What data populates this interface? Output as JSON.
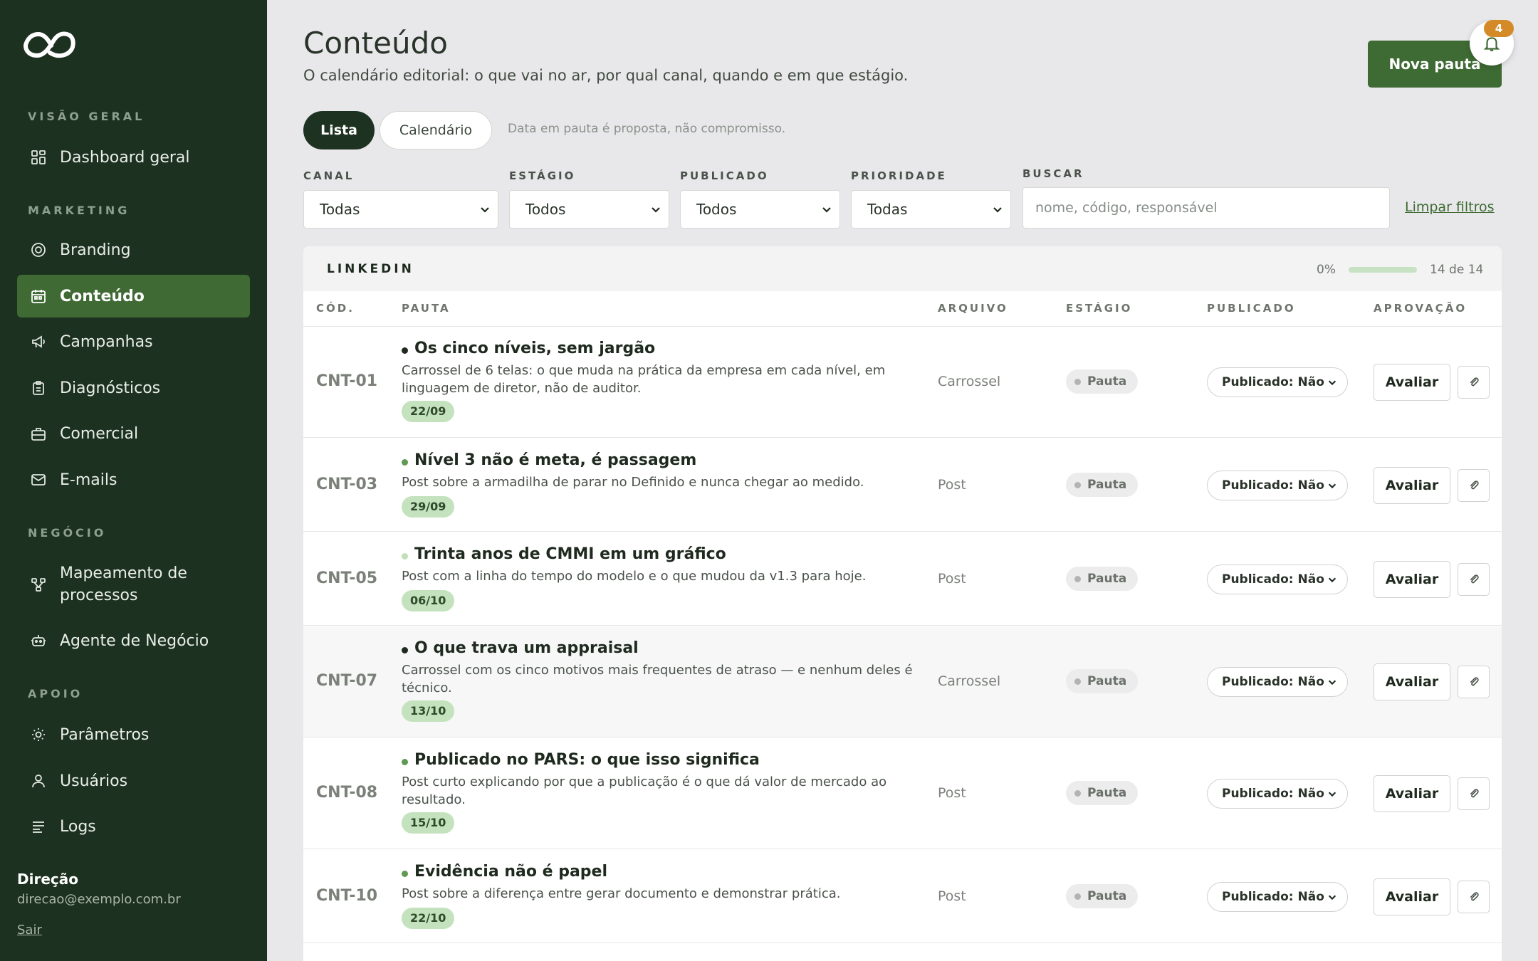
{
  "sidebar": {
    "sections": [
      {
        "label": "VISÃO GERAL"
      },
      {
        "label": "MARKETING"
      },
      {
        "label": "NEGÓCIO"
      },
      {
        "label": "APOIO"
      }
    ],
    "items": [
      {
        "label": "Dashboard geral",
        "icon": "grid-icon"
      },
      {
        "label": "Branding",
        "icon": "target-icon"
      },
      {
        "label": "Conteúdo",
        "icon": "calendar-icon",
        "active": true
      },
      {
        "label": "Campanhas",
        "icon": "megaphone-icon"
      },
      {
        "label": "Diagnósticos",
        "icon": "clipboard-icon"
      },
      {
        "label": "Comercial",
        "icon": "briefcase-icon"
      },
      {
        "label": "E-mails",
        "icon": "mail-icon"
      },
      {
        "label": "Mapeamento de processos",
        "icon": "flow-icon"
      },
      {
        "label": "Agente de Negócio",
        "icon": "bot-icon"
      },
      {
        "label": "Parâmetros",
        "icon": "sun-icon"
      },
      {
        "label": "Usuários",
        "icon": "user-icon"
      },
      {
        "label": "Logs",
        "icon": "list-icon"
      }
    ],
    "user": {
      "name": "Direção",
      "email": "direcao@exemplo.com.br",
      "logout": "Sair"
    }
  },
  "header": {
    "title": "Conteúdo",
    "subtitle": "O calendário editorial: o que vai no ar, por qual canal, quando e em que estágio.",
    "new_button": "Nova pauta",
    "notification_count": "4"
  },
  "view_toggle": {
    "list": "Lista",
    "calendar": "Calendário",
    "note": "Data em pauta é proposta, não compromisso."
  },
  "filters": {
    "canal": {
      "label": "CANAL",
      "value": "Todas"
    },
    "estagio": {
      "label": "ESTÁGIO",
      "value": "Todos"
    },
    "publicado": {
      "label": "PUBLICADO",
      "value": "Todos"
    },
    "prioridade": {
      "label": "PRIORIDADE",
      "value": "Todas"
    },
    "buscar": {
      "label": "BUSCAR",
      "placeholder": "nome, código, responsável",
      "value": ""
    },
    "clear": "Limpar filtros"
  },
  "group": {
    "title": "LINKEDIN",
    "progress_text": "0%",
    "progress_fraction": 0,
    "count_text": "14 de 14",
    "columns": {
      "cod": "CÓD.",
      "pauta": "PAUTA",
      "arquivo": "ARQUIVO",
      "estagio": "ESTÁGIO",
      "publicado": "PUBLICADO",
      "aprovacao": "APROVAÇÃO"
    },
    "rows": [
      {
        "code": "CNT-01",
        "title": "Os cinco níveis, sem jargão",
        "desc": "Carrossel de 6 telas: o que muda na prática da empresa em cada nível, em linguagem de diretor, não de auditor.",
        "date": "22/09",
        "file": "Carrossel",
        "stage": "Pauta",
        "published": "Publicado: Não",
        "approve": "Avaliar",
        "dot_color": "#1f2a1f"
      },
      {
        "code": "CNT-03",
        "title": "Nível 3 não é meta, é passagem",
        "desc": "Post sobre a armadilha de parar no Definido e nunca chegar ao medido.",
        "date": "29/09",
        "file": "Post",
        "stage": "Pauta",
        "published": "Publicado: Não",
        "approve": "Avaliar",
        "dot_color": "#5f9a52"
      },
      {
        "code": "CNT-05",
        "title": "Trinta anos de CMMI em um gráfico",
        "desc": "Post com a linha do tempo do modelo e o que mudou da v1.3 para hoje.",
        "date": "06/10",
        "file": "Post",
        "stage": "Pauta",
        "published": "Publicado: Não",
        "approve": "Avaliar",
        "dot_color": "#bfe0b8"
      },
      {
        "code": "CNT-07",
        "title": "O que trava um appraisal",
        "desc": "Carrossel com os cinco motivos mais frequentes de atraso — e nenhum deles é técnico.",
        "date": "13/10",
        "file": "Carrossel",
        "stage": "Pauta",
        "published": "Publicado: Não",
        "approve": "Avaliar",
        "dot_color": "#1f2a1f"
      },
      {
        "code": "CNT-08",
        "title": "Publicado no PARS: o que isso significa",
        "desc": "Post curto explicando por que a publicação é o que dá valor de mercado ao resultado.",
        "date": "15/10",
        "file": "Post",
        "stage": "Pauta",
        "published": "Publicado: Não",
        "approve": "Avaliar",
        "dot_color": "#5f9a52"
      },
      {
        "code": "CNT-10",
        "title": "Evidência não é papel",
        "desc": "Post sobre a diferença entre gerar documento e demonstrar prática.",
        "date": "22/10",
        "file": "Post",
        "stage": "Pauta",
        "published": "Publicado: Não",
        "approve": "Avaliar",
        "dot_color": "#5f9a52"
      }
    ]
  },
  "colors": {
    "sidebar_bg": "#1c3120",
    "accent": "#3e6a33",
    "badge": "#d48a26",
    "date_chip": "#c4e2be"
  }
}
